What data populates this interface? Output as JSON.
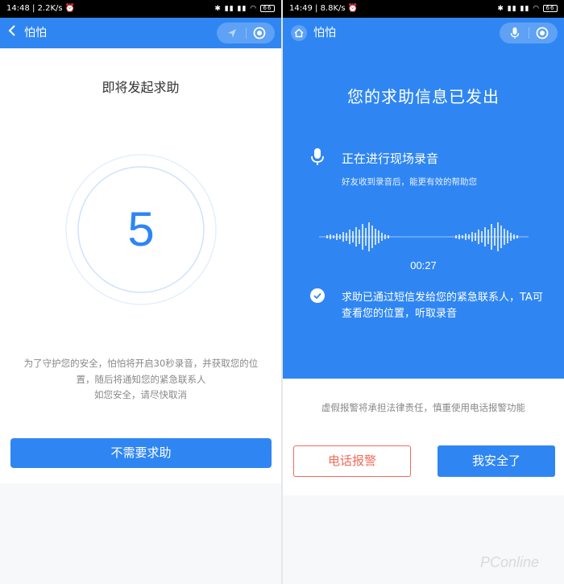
{
  "colors": {
    "primary": "#2f86f2",
    "danger": "#f26b5b",
    "status_bar": "#000000",
    "muted_text": "#888888"
  },
  "left_screen": {
    "status_bar": {
      "time": "14:48",
      "speed": "2.2K/s",
      "battery": "66"
    },
    "title_bar": {
      "back_icon": "chevron-left-icon",
      "title": "怕怕",
      "capsule_icons": [
        "location-arrow-icon",
        "record-circle-icon"
      ]
    },
    "heading": "即将发起求助",
    "countdown": {
      "value": "5"
    },
    "notice": "为了守护您的安全，怕怕将开启30秒录音，并获取您的位置，随后将通知您的紧急联系人",
    "notice_secondary": "如您安全，请尽快取消",
    "cancel_button": "不需要求助"
  },
  "right_screen": {
    "status_bar": {
      "time": "14:49",
      "speed": "8.8K/s",
      "battery": "66"
    },
    "title_bar": {
      "home_icon": "home-icon",
      "title": "怕怕",
      "capsule_icons": [
        "microphone-icon",
        "record-circle-icon"
      ]
    },
    "heading": "您的求助信息已发出",
    "recording": {
      "title": "正在进行现场录音",
      "subtitle": "好友收到录音后，能更有效的帮助您",
      "timer": "00:27"
    },
    "sent_message": "求助已通过短信发给您的紧急联系人，TA可查看您的位置，听取录音",
    "warning": "虚假报警将承担法律责任，慎重使用电话报警功能",
    "call_police_button": "电话报警",
    "safe_button": "我安全了"
  },
  "watermark": "PConline"
}
